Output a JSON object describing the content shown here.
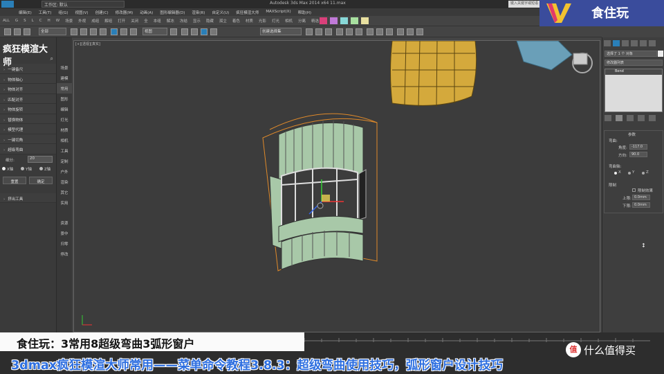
{
  "window": {
    "title": "Autodesk 3ds Max 2014 x64   11.max",
    "workspace": "工作区: 默认",
    "search_placeholder": "键入关键字或短语"
  },
  "menu": [
    "编辑(E)",
    "工具(T)",
    "组(G)",
    "视图(V)",
    "创建(C)",
    "修改器(M)",
    "动画(A)",
    "图形编辑器(D)",
    "渲染(R)",
    "自定义(U)",
    "疯狂模渲大师",
    "MAXScript(X)",
    "帮助(H)"
  ],
  "toolbar1": [
    "ALL",
    "G",
    "S",
    "L",
    "C",
    "H",
    "W",
    "场景",
    "外视",
    "成组",
    "解组",
    "打开",
    "关闭",
    "全",
    "本组",
    "解冻",
    "冻结",
    "显示",
    "隐藏",
    "孤立",
    "着色",
    "材质",
    "光影",
    "灯光",
    "相机",
    "分离",
    "精选"
  ],
  "toolbar2": {
    "selection_filter": "全部",
    "view_mode": "视图",
    "named_selection": "创建选择集"
  },
  "brand": {
    "label": "食住玩"
  },
  "left_panel": {
    "title": "疯狂模渲大师",
    "items": [
      "一键备尺",
      "物体轴心",
      "物体对齐",
      "匹配对齐",
      "物体旋转",
      "替换物体",
      "模型代理",
      "一键切角",
      "超级弯曲"
    ],
    "segments_label": "细分:",
    "segments_value": "20",
    "axes": [
      "X轴",
      "Y轴",
      "Z轴"
    ],
    "reset_label": "重置",
    "ok_label": "确定",
    "extra_item": "挤出工具"
  },
  "tab_column": [
    "场景",
    "建模",
    "常用",
    "图形",
    "编辑",
    "灯光",
    "材质",
    "相机",
    "工具",
    "定制",
    "户外",
    "渲染",
    "其它",
    "实用"
  ],
  "tab_column_bottom": [
    "资源",
    "景中",
    "归零",
    "停改"
  ],
  "viewport": {
    "label": "[+][透视][真实]"
  },
  "right_panel": {
    "object_name": "选择了 1 个 对象",
    "modifier_list": "修改器列表",
    "stack_item": "Bend",
    "rollout_title": "参数",
    "bend_group": "弯曲:",
    "angle_label": "角度:",
    "angle_value": "-117.0",
    "direction_label": "方向:",
    "direction_value": "90.0",
    "axis_group": "弯曲轴:",
    "axis_x": "X",
    "axis_y": "Y",
    "axis_z": "Z",
    "limits_group": "限制",
    "limit_effect": "限制效果",
    "upper_label": "上限:",
    "upper_value": "0.0mm",
    "lower_label": "下限:",
    "lower_value": "0.0mm"
  },
  "captions": {
    "line1": "食住玩：3常用8超级弯曲3弧形窗户",
    "line2": "3dmax疯狂模渲大师常用——菜单命令教程3.8.3：超级弯曲使用技巧，弧形窗户设计技巧"
  },
  "watermark": {
    "badge": "值",
    "text": "什么值得买"
  },
  "colors": {
    "brand_bg": "#3a4c9c",
    "caption_blue": "#2e6fe0",
    "viewport_bg": "#3c3c3c",
    "selection_orange": "#e08a2a",
    "glass_green": "#a8c8a8",
    "wood_gold": "#d4a93c"
  }
}
